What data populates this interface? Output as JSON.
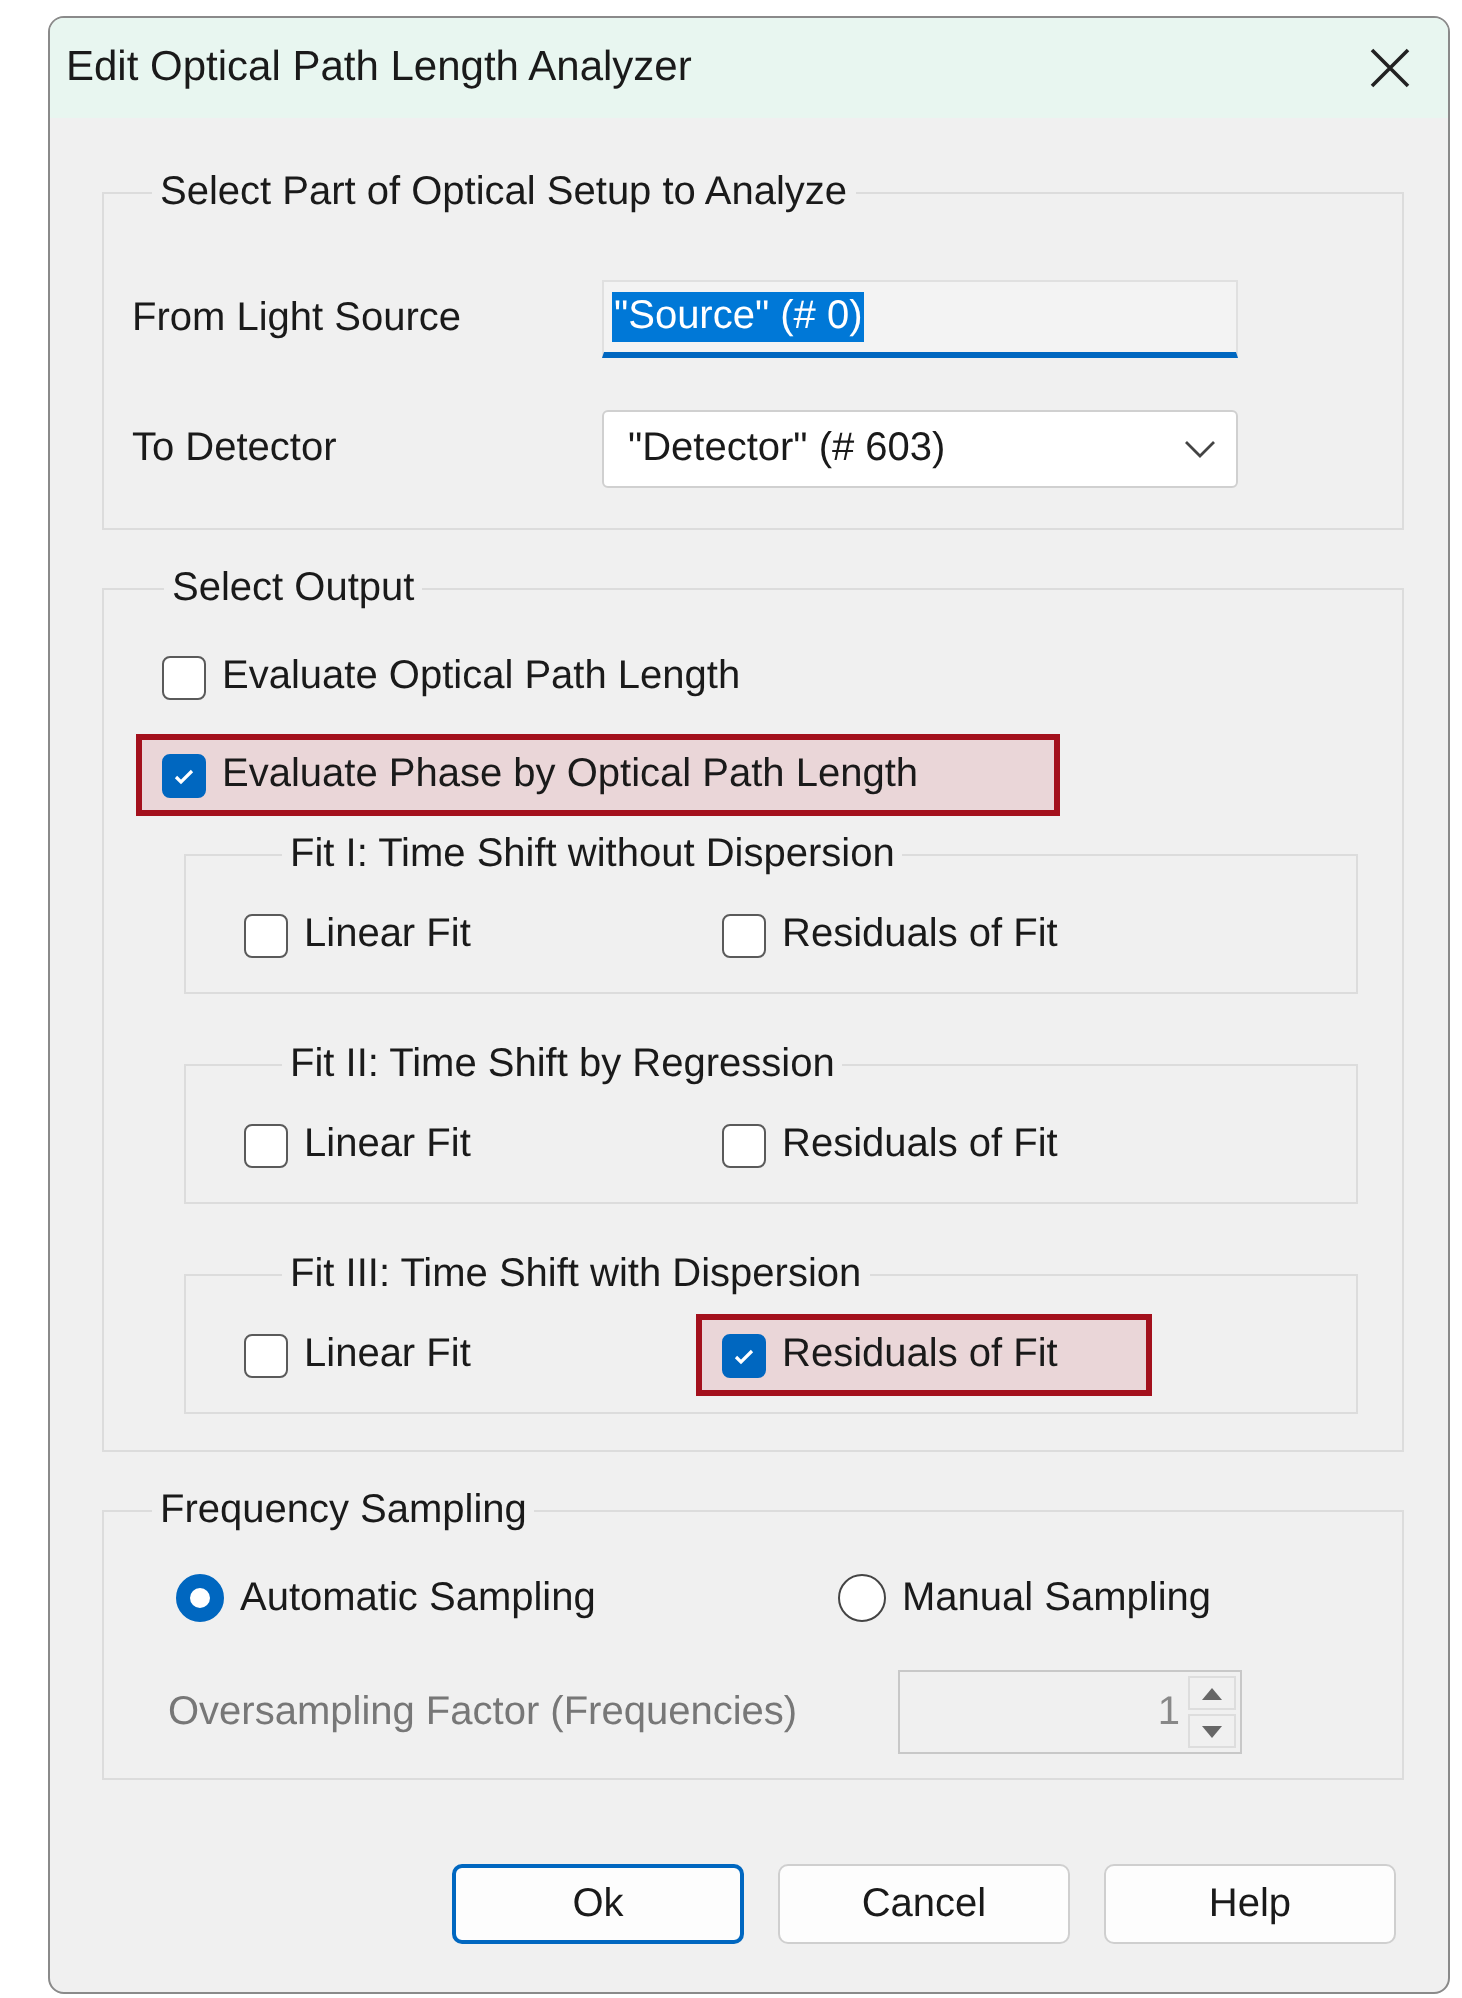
{
  "window": {
    "title": "Edit Optical Path Length Analyzer"
  },
  "setup_group": {
    "title": "Select Part of Optical Setup to Analyze",
    "fields": [
      {
        "label": "From Light Source",
        "kind": "text",
        "value": "\"Source\" (# 0)",
        "focused": true
      },
      {
        "label": "To Detector",
        "kind": "dropdown",
        "value": "\"Detector\" (# 603)",
        "focused": false
      }
    ]
  },
  "output_group": {
    "title": "Select Output",
    "options": [
      {
        "label": "Evaluate Optical Path Length",
        "checked": false,
        "highlighted": false
      },
      {
        "label": "Evaluate Phase by Optical Path Length",
        "checked": true,
        "highlighted": true
      }
    ],
    "fits": [
      {
        "title": "Fit I: Time Shift without Dispersion",
        "options": [
          {
            "label": "Linear Fit",
            "checked": false,
            "highlighted": false
          },
          {
            "label": "Residuals of Fit",
            "checked": false,
            "highlighted": false
          }
        ]
      },
      {
        "title": "Fit II: Time Shift by Regression",
        "options": [
          {
            "label": "Linear Fit",
            "checked": false,
            "highlighted": false
          },
          {
            "label": "Residuals of Fit",
            "checked": false,
            "highlighted": false
          }
        ]
      },
      {
        "title": "Fit III: Time Shift with Dispersion",
        "options": [
          {
            "label": "Linear Fit",
            "checked": false,
            "highlighted": false
          },
          {
            "label": "Residuals of Fit",
            "checked": true,
            "highlighted": true
          }
        ]
      }
    ]
  },
  "sampling_group": {
    "title": "Frequency Sampling",
    "modes": [
      {
        "label": "Automatic Sampling",
        "selected": true
      },
      {
        "label": "Manual Sampling",
        "selected": false
      }
    ],
    "oversampling": {
      "label": "Oversampling Factor (Frequencies)",
      "value": "1",
      "disabled": true
    }
  },
  "buttons": [
    {
      "label": "Ok",
      "default": true
    },
    {
      "label": "Cancel",
      "default": false
    },
    {
      "label": "Help",
      "default": false
    }
  ]
}
